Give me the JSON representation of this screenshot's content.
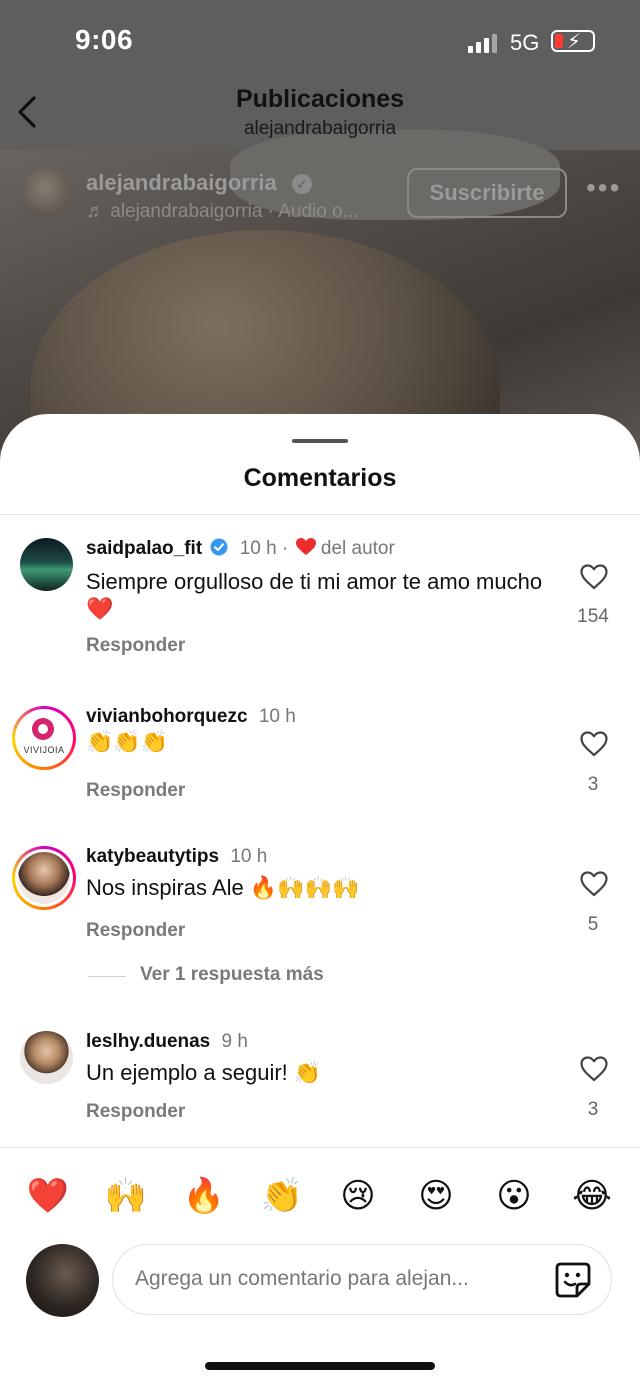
{
  "status_bar": {
    "time": "9:06",
    "network": "5G"
  },
  "header": {
    "title": "Publicaciones",
    "subtitle": "alejandrabaigorria"
  },
  "post": {
    "username": "alejandrabaigorria",
    "audio": "♬ alejandrabaigorria · Audio o...",
    "subscribe_label": "Suscribirte",
    "more": "•••"
  },
  "sheet": {
    "title": "Comentarios"
  },
  "comments": [
    {
      "user": "saidpalao_fit",
      "verified": true,
      "time": "10 h",
      "dot": "·",
      "liked_by_author": "del autor",
      "text": "Siempre orgulloso de ti mi amor te amo mucho ❤️",
      "reply": "Responder",
      "likes": "154"
    },
    {
      "user": "vivianbohorquezc",
      "time": "10 h",
      "text": "👏👏👏",
      "reply": "Responder",
      "likes": "3",
      "avatar_label": "VIVIJOIA"
    },
    {
      "user": "katybeautytips",
      "time": "10 h",
      "text": "Nos inspiras Ale 🔥🙌🙌🙌",
      "reply": "Responder",
      "likes": "5"
    },
    {
      "user": "leslhy.duenas",
      "time": "9 h",
      "text": "Un ejemplo a seguir! 👏",
      "reply": "Responder",
      "likes": "3"
    }
  ],
  "more_replies": "Ver 1 respuesta más",
  "emojis": [
    "❤️",
    "🙌",
    "🔥",
    "👏",
    "😢",
    "😍",
    "😮",
    "😂"
  ],
  "composer": {
    "placeholder": "Agrega un comentario para alejan..."
  },
  "colors": {
    "verified": "#3897f0",
    "heart_red": "#ed2d2d",
    "background_dim": "#5e5e5e"
  }
}
